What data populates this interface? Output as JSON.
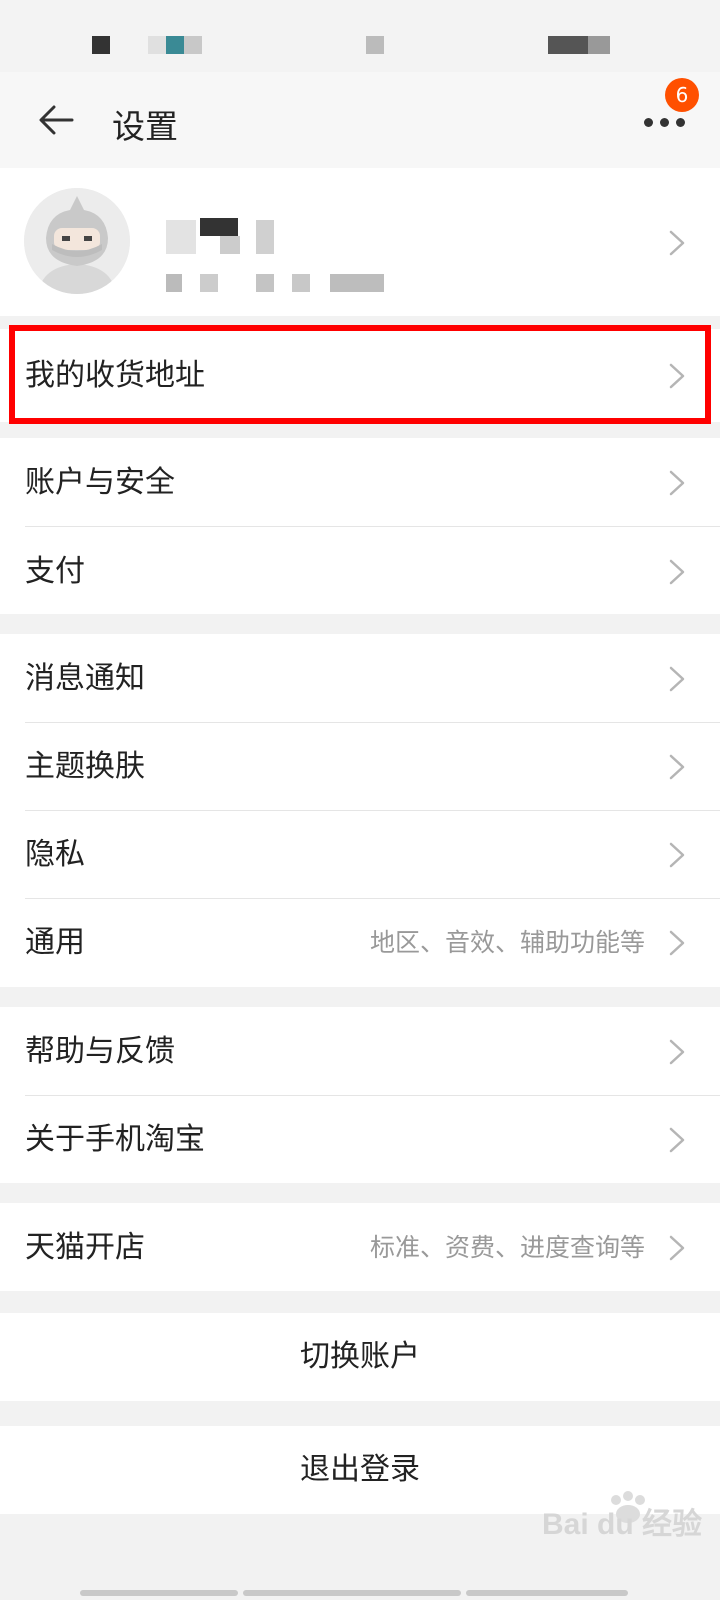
{
  "nav": {
    "title": "设置",
    "badge_count": "6"
  },
  "menu": {
    "address": "我的收货地址",
    "account_security": "账户与安全",
    "payment": "支付",
    "notifications": "消息通知",
    "theme": "主题换肤",
    "privacy": "隐私",
    "general": "通用",
    "general_hint": "地区、音效、辅助功能等",
    "help_feedback": "帮助与反馈",
    "about": "关于手机淘宝",
    "tmall_store": "天猫开店",
    "tmall_hint": "标准、资费、进度查询等"
  },
  "actions": {
    "switch_account": "切换账户",
    "logout": "退出登录"
  },
  "watermark": "Bai du 经验",
  "colors": {
    "accent": "#ff5000",
    "highlight_box": "#ff0000"
  }
}
